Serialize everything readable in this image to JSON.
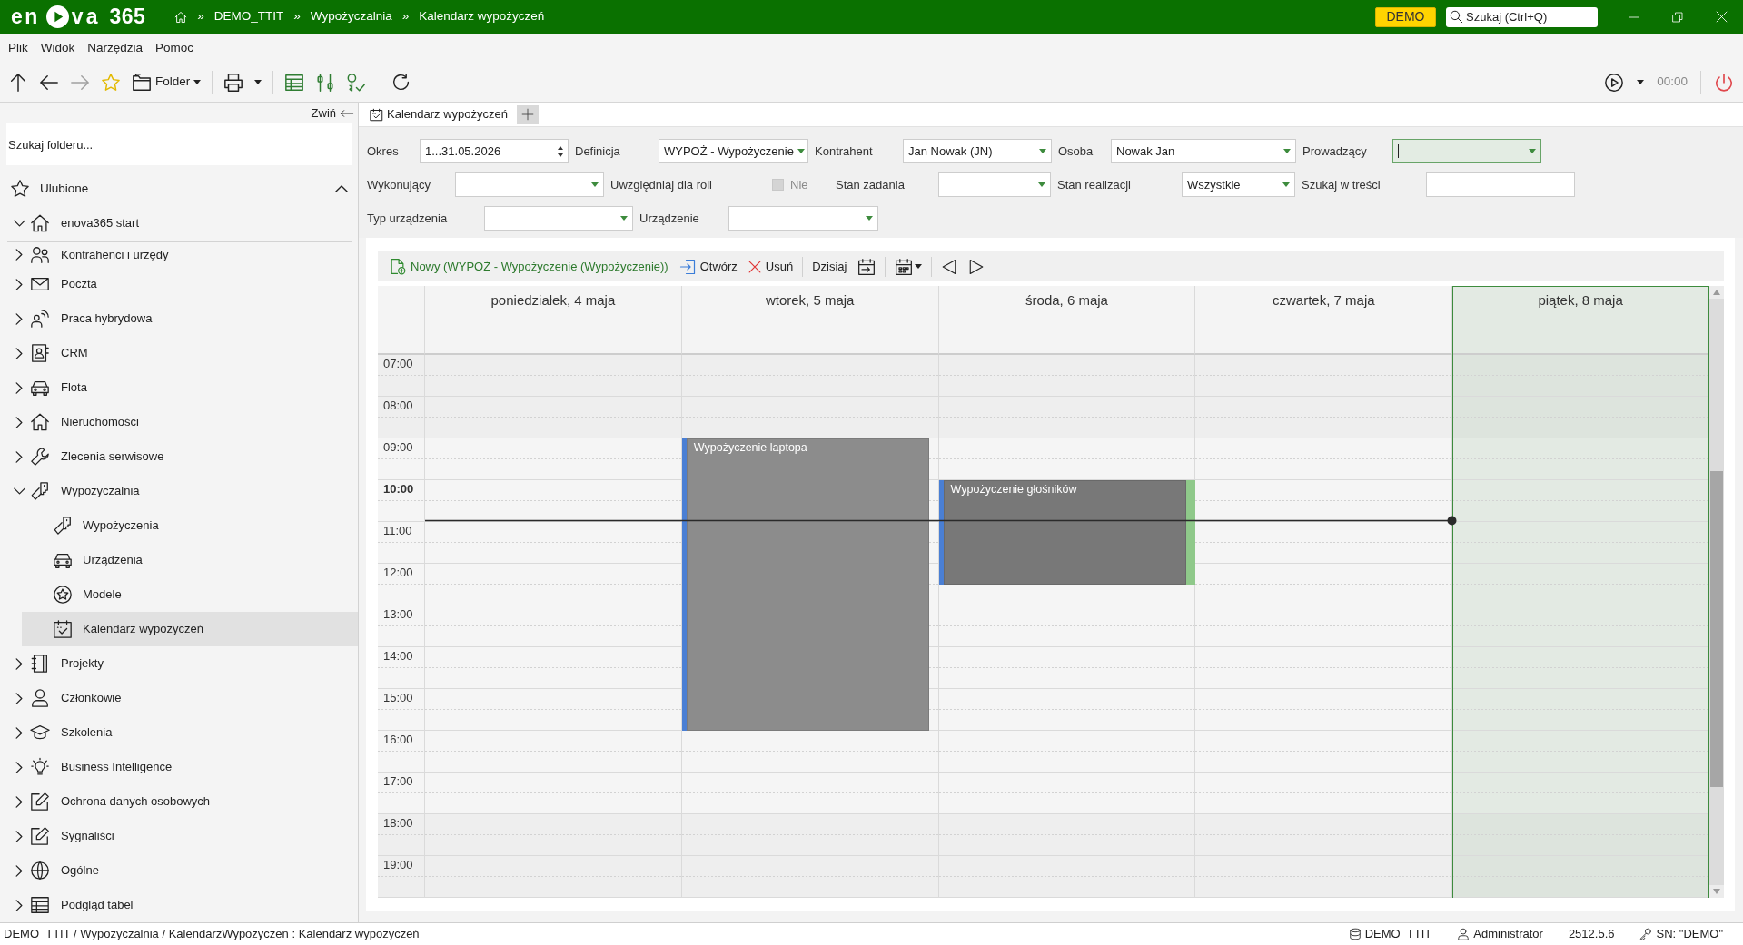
{
  "title_bar": {
    "logo": {
      "lead": "en",
      "tail": "va",
      "number": "365"
    },
    "breadcrumb": [
      {
        "separator": "»",
        "label": "DEMO_TTIT"
      },
      {
        "separator": "»",
        "label": "Wypożyczalnia"
      },
      {
        "separator": "»",
        "label": "Kalendarz wypożyczeń"
      }
    ],
    "badge": "DEMO",
    "search": {
      "placeholder": "Szukaj (Ctrl+Q)"
    }
  },
  "menu": [
    "Plik",
    "Widok",
    "Narzędzia",
    "Pomoc"
  ],
  "toolbar": {
    "navigation": [
      {
        "disabled": false
      },
      {
        "disabled": false
      },
      {
        "disabled": true
      }
    ],
    "folder_button": "Folder",
    "timer": "00:00"
  },
  "sidebar": {
    "collapse": "Zwiń",
    "search": {
      "placeholder": "Szukaj folderu..."
    },
    "favorites": {
      "label": "Ulubione",
      "expanded": true,
      "items": [
        {
          "label": "enova365 start",
          "expanded": true,
          "selected": false
        }
      ]
    },
    "tree": [
      {
        "label": "Kontrahenci i urzędy",
        "expanded": false,
        "selected": false
      },
      {
        "label": "Poczta",
        "expanded": false,
        "selected": false
      },
      {
        "label": "Praca hybrydowa",
        "expanded": false,
        "selected": false
      },
      {
        "label": "CRM",
        "expanded": false,
        "selected": false
      },
      {
        "label": "Flota",
        "expanded": false,
        "selected": false
      },
      {
        "label": "Nieruchomości",
        "expanded": false,
        "selected": false
      },
      {
        "label": "Zlecenia serwisowe",
        "expanded": false,
        "selected": false
      },
      {
        "label": "Wypożyczalnia",
        "expanded": true,
        "selected": false,
        "children": [
          {
            "label": "Wypożyczenia",
            "selected": false
          },
          {
            "label": "Urządzenia",
            "selected": false
          },
          {
            "label": "Modele",
            "selected": false
          },
          {
            "label": "Kalendarz wypożyczeń",
            "selected": true
          }
        ]
      },
      {
        "label": "Projekty",
        "expanded": false,
        "selected": false
      },
      {
        "label": "Członkowie",
        "expanded": false,
        "selected": false
      },
      {
        "label": "Szkolenia",
        "expanded": false,
        "selected": false
      },
      {
        "label": "Business Intelligence",
        "expanded": false,
        "selected": false
      },
      {
        "label": "Ochrona danych osobowych",
        "expanded": false,
        "selected": false
      },
      {
        "label": "Sygnaliści",
        "expanded": false,
        "selected": false
      },
      {
        "label": "Ogólne",
        "expanded": false,
        "selected": false
      },
      {
        "label": "Podgląd tabel",
        "expanded": false,
        "selected": false
      }
    ]
  },
  "tabs": [
    {
      "label": "Kalendarz wypożyczeń",
      "selected": true
    }
  ],
  "filters": {
    "rows": [
      {
        "fields": [
          {
            "label": "Okres",
            "kind": "spin",
            "value": "1...31.05.2026",
            "focused": false
          },
          {
            "label": "Definicja",
            "kind": "select",
            "value": "WYPOŻ - Wypożyczenie",
            "focused": false
          },
          {
            "label": "Kontrahent",
            "kind": "select",
            "value": "Jan Nowak (JN)",
            "focused": false
          },
          {
            "label": "Osoba",
            "kind": "select",
            "value": "Nowak Jan",
            "focused": false
          },
          {
            "label": "Prowadzący",
            "kind": "select",
            "focused": true
          }
        ]
      },
      {
        "fields": [
          {
            "label": "Wykonujący",
            "kind": "select",
            "focused": false
          },
          {
            "label": "Uwzględniaj dla roli",
            "kind": "checkbox",
            "checked": false,
            "disabled": true,
            "caption": "Nie"
          },
          {
            "label": "Stan zadania",
            "kind": "select",
            "focused": false
          },
          {
            "label": "Stan realizacji",
            "kind": "select",
            "value": "Wszystkie",
            "focused": false
          },
          {
            "label": "Szukaj w treści",
            "kind": "text",
            "focused": false
          }
        ]
      },
      {
        "fields": [
          {
            "label": "Typ urządzenia",
            "kind": "select",
            "focused": false
          },
          {
            "label": "Urządzenie",
            "kind": "select",
            "focused": false
          }
        ]
      }
    ]
  },
  "calendar_toolbar": [
    {
      "kind": "create",
      "label": "Nowy (WYPOŻ - Wypożyczenie (Wypożyczenie))"
    },
    {
      "kind": "open",
      "label": "Otwórz"
    },
    {
      "kind": "delete",
      "label": "Usuń"
    },
    {
      "kind": "today",
      "label": "Dzisiaj"
    }
  ],
  "calendar": {
    "days": [
      {
        "label": "poniedziałek, 4 maja",
        "today": false
      },
      {
        "label": "wtorek, 5 maja",
        "today": false,
        "events": [
          {
            "title": "Wypożyczenie laptopa",
            "color": "#8c8c8c",
            "side_strip": false
          }
        ]
      },
      {
        "label": "środa, 6 maja",
        "today": false,
        "events": [
          {
            "title": "Wypożyczenie głośników",
            "color": "#787878",
            "side_strip": true
          }
        ]
      },
      {
        "label": "czwartek, 7 maja",
        "today": false
      },
      {
        "label": "piątek, 8 maja",
        "today": true
      }
    ],
    "hours": [
      {
        "label": "07:00",
        "working": false,
        "current": false
      },
      {
        "label": "08:00",
        "working": false,
        "current": false
      },
      {
        "label": "09:00",
        "working": true,
        "current": false
      },
      {
        "label": "10:00",
        "working": true,
        "current": true
      },
      {
        "label": "11:00",
        "working": true,
        "current": false
      },
      {
        "label": "12:00",
        "working": true,
        "current": false
      },
      {
        "label": "13:00",
        "working": true,
        "current": false
      },
      {
        "label": "14:00",
        "working": true,
        "current": false
      },
      {
        "label": "15:00",
        "working": true,
        "current": false
      },
      {
        "label": "16:00",
        "working": true,
        "current": false
      },
      {
        "label": "17:00",
        "working": true,
        "current": false
      },
      {
        "label": "18:00",
        "working": false,
        "current": false
      },
      {
        "label": "19:00",
        "working": false,
        "current": false
      }
    ]
  },
  "status_bar": {
    "path": "DEMO_TTIT / Wypozyczalnia / KalendarzWypozyczen : Kalendarz wypożyczeń",
    "database": "DEMO_TTIT",
    "user": "Administrator",
    "version": "2512.5.6",
    "serial": "SN: \"DEMO\""
  }
}
